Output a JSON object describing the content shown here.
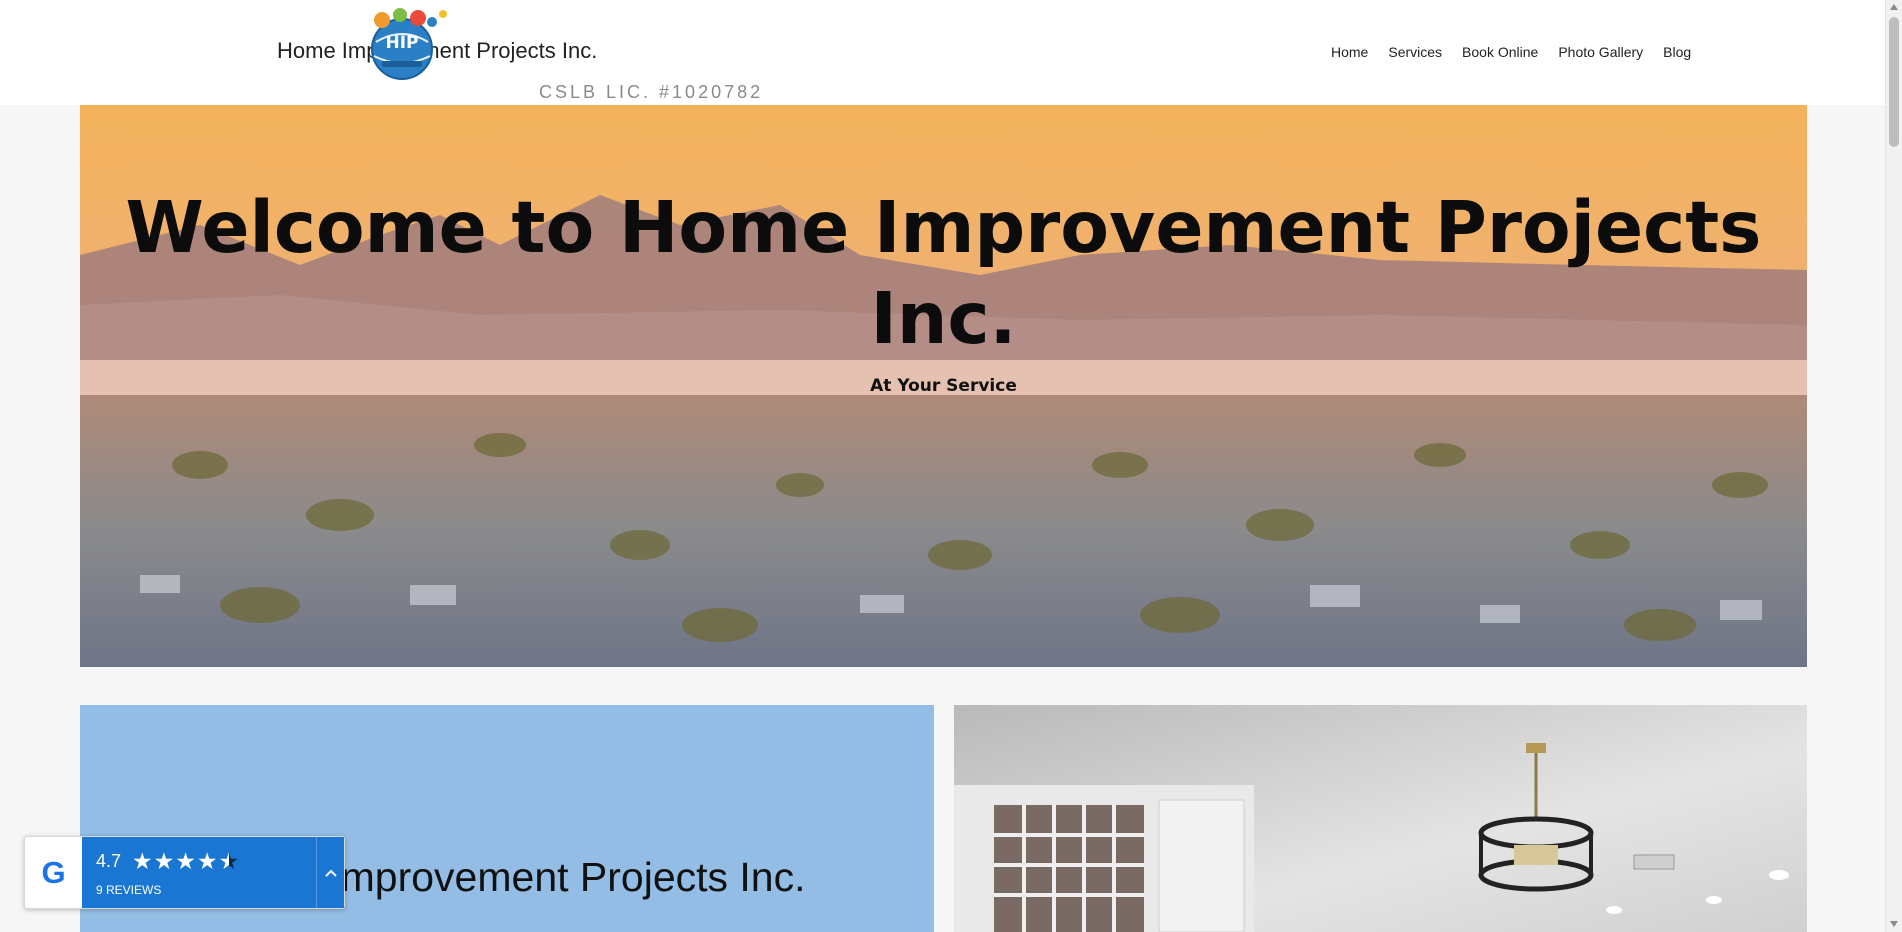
{
  "header": {
    "brand_name": "Home Improvement Projects Inc.",
    "license": "CSLB LIC. #1020782",
    "nav": [
      "Home",
      "Services",
      "Book Online",
      "Photo Gallery",
      "Blog"
    ]
  },
  "hero": {
    "title": "Welcome to Home Improvement Projects Inc.",
    "subtitle": "At Your Service"
  },
  "intro": {
    "heading": "Home Improvement Projects Inc."
  },
  "review_widget": {
    "rating": "4.7",
    "stars": 4.5,
    "count_label": "9 REVIEWS",
    "logo_letter": "G",
    "toggle_icon": "chevron-up-icon"
  },
  "colors": {
    "hero_sky": "#f3b35b",
    "panel_blue": "#94bde5",
    "widget_blue": "#1976d2"
  }
}
